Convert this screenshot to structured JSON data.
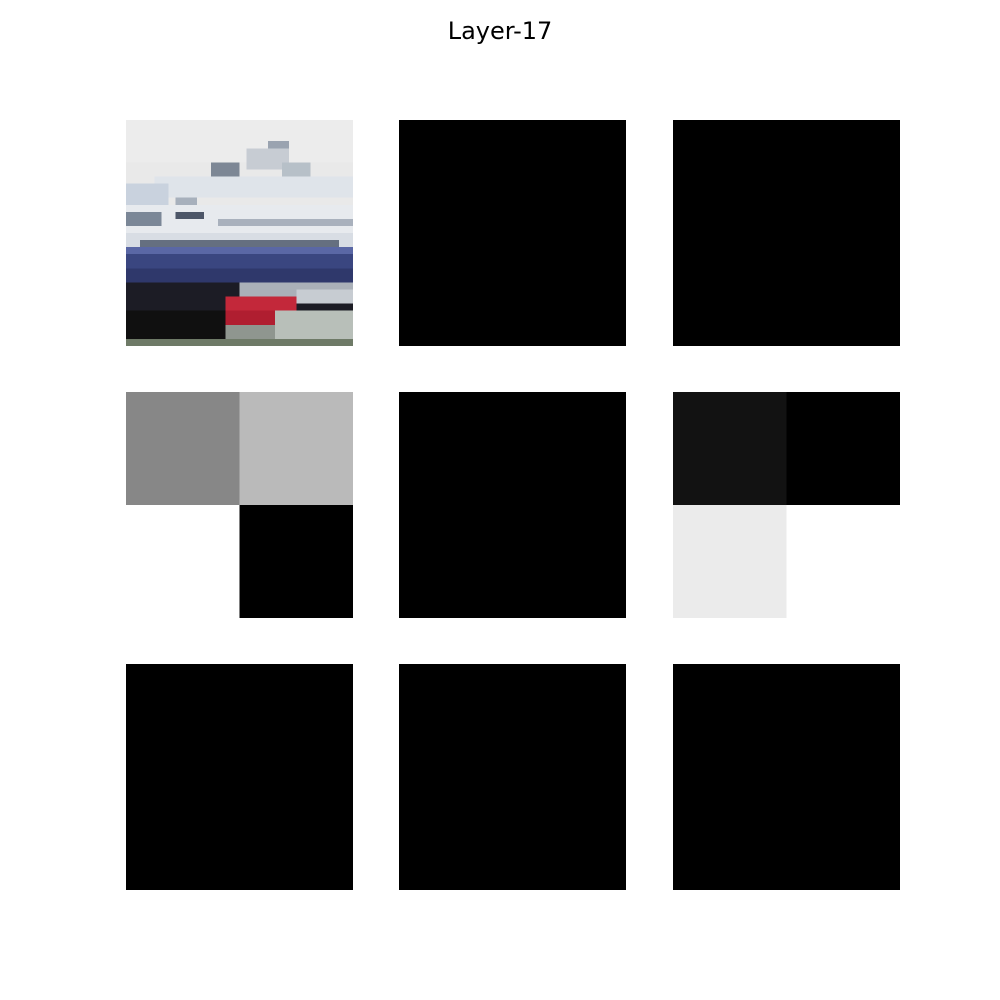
{
  "title": "Layer-17",
  "panels": [
    {
      "id": "input-image",
      "kind": "image",
      "subject": "ship"
    },
    {
      "id": "feature-map-1",
      "kind": "activation",
      "grid": [
        [
          0,
          0
        ],
        [
          0,
          0
        ]
      ]
    },
    {
      "id": "feature-map-2",
      "kind": "activation",
      "grid": [
        [
          0,
          0
        ],
        [
          0,
          0
        ]
      ]
    },
    {
      "id": "feature-map-3",
      "kind": "activation",
      "grid": [
        [
          0.53,
          0.73
        ],
        [
          1.0,
          0
        ]
      ]
    },
    {
      "id": "feature-map-4",
      "kind": "activation",
      "grid": [
        [
          0,
          0
        ],
        [
          0,
          0
        ]
      ]
    },
    {
      "id": "feature-map-5",
      "kind": "activation",
      "grid": [
        [
          0.07,
          0
        ],
        [
          0.92,
          1.0
        ]
      ]
    },
    {
      "id": "feature-map-6",
      "kind": "activation",
      "grid": [
        [
          0,
          0
        ],
        [
          0,
          0
        ]
      ]
    },
    {
      "id": "feature-map-7",
      "kind": "activation",
      "grid": [
        [
          0,
          0
        ],
        [
          0,
          0
        ]
      ]
    },
    {
      "id": "feature-map-8",
      "kind": "activation",
      "grid": [
        [
          0,
          0
        ],
        [
          0,
          0
        ]
      ]
    }
  ],
  "colors": {
    "background": "#ffffff",
    "colormap": "gray"
  }
}
